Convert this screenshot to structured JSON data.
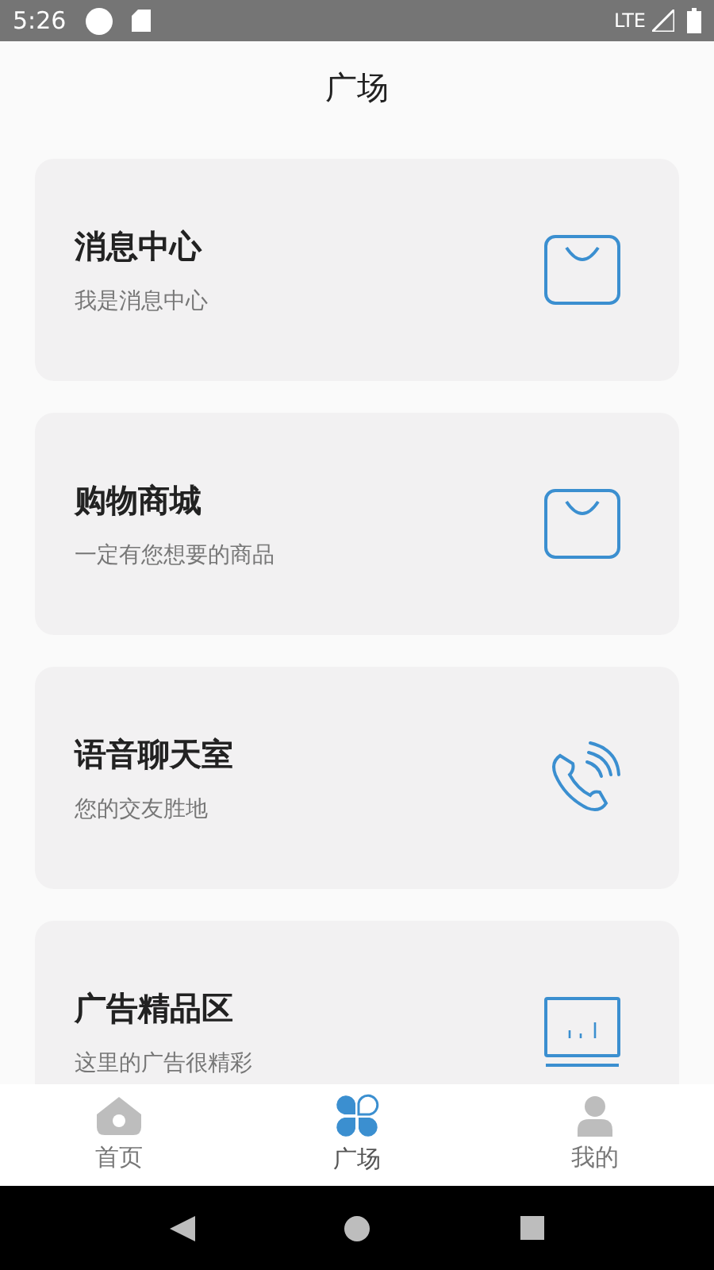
{
  "status_bar": {
    "time": "5:26",
    "network": "LTE"
  },
  "header": {
    "title": "广场"
  },
  "cards": [
    {
      "title": "消息中心",
      "subtitle": "我是消息中心",
      "kind": "bag"
    },
    {
      "title": "购物商城",
      "subtitle": "一定有您想要的商品",
      "kind": "bag"
    },
    {
      "title": "语音聊天室",
      "subtitle": "您的交友胜地",
      "kind": "phone"
    },
    {
      "title": "广告精品区",
      "subtitle": "这里的广告很精彩",
      "kind": "monitor"
    }
  ],
  "tabs": [
    {
      "label": "首页",
      "kind": "home",
      "selected": false
    },
    {
      "label": "广场",
      "kind": "clover",
      "selected": true
    },
    {
      "label": "我的",
      "kind": "person",
      "selected": false
    }
  ]
}
